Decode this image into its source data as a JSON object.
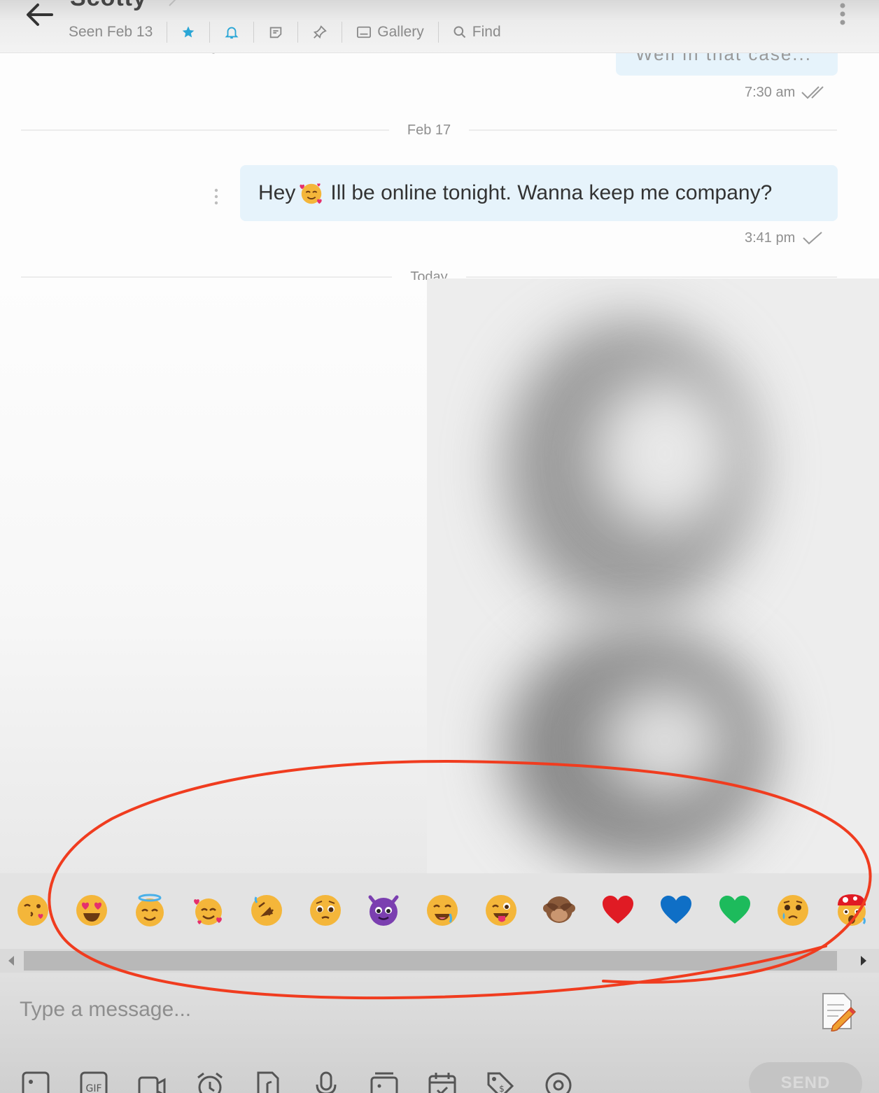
{
  "header": {
    "contact_name": "Scotty",
    "status": "Seen Feb 13",
    "gallery_label": "Gallery",
    "find_label": "Find"
  },
  "messages": {
    "top_bubble_text": "Well in that case...",
    "top_time": "7:30 am",
    "divider_1": "Feb 17",
    "msg_before_emoji": "Hey",
    "msg_after_emoji": " Ill be online tonight. Wanna keep me company?",
    "msg_time": "3:41 pm",
    "divider_2": "Today"
  },
  "emoji_bar": {
    "items": [
      "face-blowing-kiss-icon",
      "heart-eyes-icon",
      "halo-smile-icon",
      "smiling-face-with-hearts-icon",
      "rolling-laughing-icon",
      "pleading-face-icon",
      "smiling-devil-icon",
      "drooling-face-icon",
      "winking-tongue-icon",
      "see-no-evil-monkey-icon",
      "red-heart-icon",
      "blue-heart-icon",
      "green-heart-icon",
      "crying-face-icon",
      "mind-blown-face-icon"
    ]
  },
  "input": {
    "placeholder": "Type a message...",
    "send_label": "SEND"
  },
  "colors": {
    "bubble": "#e6f3fb",
    "accent": "#2aa6d6",
    "annotation": "#f03c1f"
  }
}
